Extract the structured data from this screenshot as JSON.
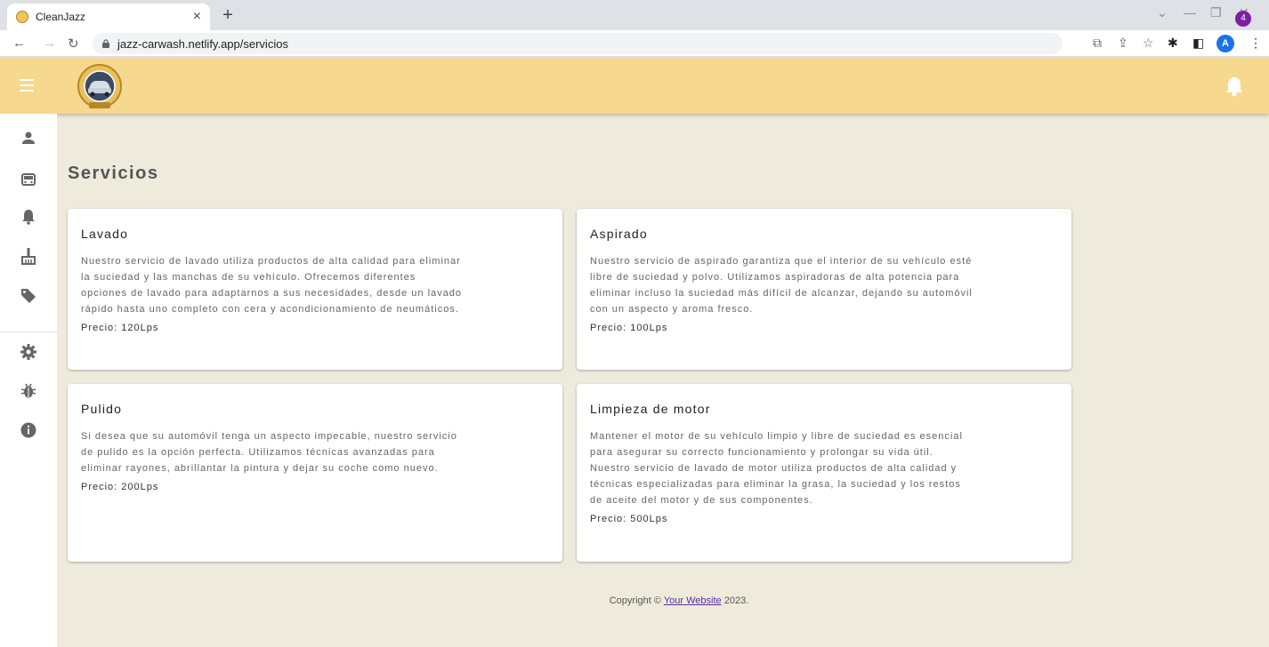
{
  "browser": {
    "tab_title": "CleanJazz",
    "tab_close": "×",
    "new_tab": "+",
    "url": "jazz-carwash.netlify.app/servicios",
    "profile_initial": "A"
  },
  "header": {
    "notification_count": "4",
    "accent_color": "#f6d88e",
    "badge_color": "#7b1fa2"
  },
  "sidebar": {
    "items": [
      {
        "icon": "person-icon"
      },
      {
        "icon": "car-icon"
      },
      {
        "icon": "bell-icon"
      },
      {
        "icon": "broom-icon"
      },
      {
        "icon": "tag-icon"
      },
      {
        "icon": "gear-icon"
      },
      {
        "icon": "bug-icon"
      },
      {
        "icon": "info-icon"
      }
    ]
  },
  "main": {
    "title": "Servicios",
    "cards": [
      {
        "title": "Lavado",
        "description": "Nuestro servicio de lavado utiliza productos de alta calidad para eliminar la suciedad y las manchas de su vehículo. Ofrecemos diferentes opciones de lavado para adaptarnos a sus necesidades, desde un lavado rápido hasta uno completo con cera y acondicionamiento de neumáticos.",
        "price": "Precio: 120Lps"
      },
      {
        "title": "Aspirado",
        "description": "Nuestro servicio de aspirado garantiza que el interior de su vehículo esté libre de suciedad y polvo. Utilizamos aspiradoras de alta potencia para eliminar incluso la suciedad más difícil de alcanzar, dejando su automóvil con un aspecto y aroma fresco.",
        "price": "Precio: 100Lps"
      },
      {
        "title": "Pulido",
        "description": "Si desea que su automóvil tenga un aspecto impecable, nuestro servicio de pulido es la opción perfecta. Utilizamos técnicas avanzadas para eliminar rayones, abrillantar la pintura y dejar su coche como nuevo.",
        "price": "Precio: 200Lps"
      },
      {
        "title": "Limpieza de motor",
        "description": "Mantener el motor de su vehículo limpio y libre de suciedad es esencial para asegurar su correcto funcionamiento y prolongar su vida útil. Nuestro servicio de lavado de motor utiliza productos de alta calidad y técnicas especializadas para eliminar la grasa, la suciedad y los restos de aceite del motor y de sus componentes.",
        "price": "Precio: 500Lps"
      }
    ]
  },
  "footer": {
    "prefix": "Copyright ©",
    "link_text": "Your Website",
    "suffix": "2023."
  }
}
